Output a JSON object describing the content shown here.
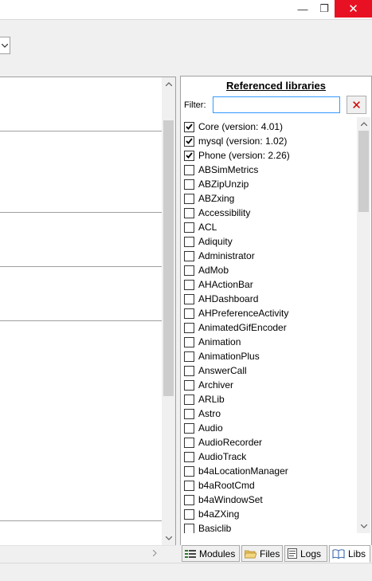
{
  "window": {
    "minimize_glyph": "—",
    "maximize_glyph": "❐",
    "close_glyph": "✕"
  },
  "libs_panel": {
    "title": "Referenced libraries",
    "filter_label": "Filter:",
    "filter_value": "",
    "clear_glyph": "✕",
    "items": [
      {
        "label": "Core (version: 4.01)",
        "checked": true
      },
      {
        "label": "mysql (version: 1.02)",
        "checked": true
      },
      {
        "label": "Phone (version: 2.26)",
        "checked": true
      },
      {
        "label": "ABSimMetrics",
        "checked": false
      },
      {
        "label": "ABZipUnzip",
        "checked": false
      },
      {
        "label": "ABZxing",
        "checked": false
      },
      {
        "label": "Accessibility",
        "checked": false
      },
      {
        "label": "ACL",
        "checked": false
      },
      {
        "label": "Adiquity",
        "checked": false
      },
      {
        "label": "Administrator",
        "checked": false
      },
      {
        "label": "AdMob",
        "checked": false
      },
      {
        "label": "AHActionBar",
        "checked": false
      },
      {
        "label": "AHDashboard",
        "checked": false
      },
      {
        "label": "AHPreferenceActivity",
        "checked": false
      },
      {
        "label": "AnimatedGifEncoder",
        "checked": false
      },
      {
        "label": "Animation",
        "checked": false
      },
      {
        "label": "AnimationPlus",
        "checked": false
      },
      {
        "label": "AnswerCall",
        "checked": false
      },
      {
        "label": "Archiver",
        "checked": false
      },
      {
        "label": "ARLib",
        "checked": false
      },
      {
        "label": "Astro",
        "checked": false
      },
      {
        "label": "Audio",
        "checked": false
      },
      {
        "label": "AudioRecorder",
        "checked": false
      },
      {
        "label": "AudioTrack",
        "checked": false
      },
      {
        "label": "b4aLocationManager",
        "checked": false
      },
      {
        "label": "b4aRootCmd",
        "checked": false
      },
      {
        "label": "b4aWindowSet",
        "checked": false
      },
      {
        "label": "b4aZXing",
        "checked": false
      },
      {
        "label": "Basiclib",
        "checked": false
      }
    ]
  },
  "tabs": [
    {
      "label": "Modules",
      "icon": "modules-icon",
      "active": false
    },
    {
      "label": "Files",
      "icon": "folder-icon",
      "active": false
    },
    {
      "label": "Logs",
      "icon": "logs-icon",
      "active": false
    },
    {
      "label": "Libs",
      "icon": "book-icon",
      "active": true
    }
  ],
  "colors": {
    "close_button": "#e81123",
    "filter_border": "#3399ff",
    "clear_x": "#d40000"
  }
}
